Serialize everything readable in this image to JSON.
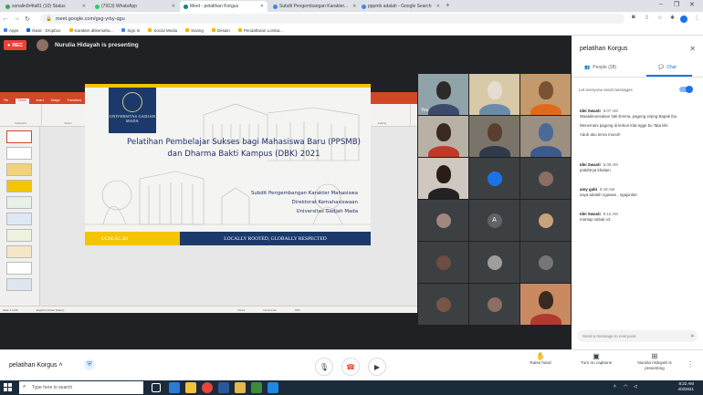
{
  "browser": {
    "tabs": [
      {
        "label": "sonalin9r4ta81 (10) Status",
        "color": "#34a853"
      },
      {
        "label": "(7913) WhatsApp",
        "color": "#25d366"
      },
      {
        "label": "Meet - pelatihan Korgus",
        "color": "#00897b"
      },
      {
        "label": "Subdit Pengembangan Karakter...",
        "color": "#4285f4"
      },
      {
        "label": "pppmb adalah - Google Search",
        "color": "#4285f4"
      }
    ],
    "new_tab": "+",
    "url": "meet.google.com/gsg-yrby-qgu",
    "bookmarks": [
      "Apps",
      "Ikwal · Dropbox",
      "Karakter ditkemaha...",
      "Sign In",
      "Social Media",
      "Saving",
      "Desain",
      "Pendaftaran Lomba..."
    ]
  },
  "meet": {
    "rec": "REC",
    "presenting": "Nurulia Hidayah is presenting",
    "you_label": "You",
    "avatar_letter": "A",
    "meeting_name": "pelatihan Korgus",
    "controls": {
      "raise_hand": "Raise hand",
      "captions": "Turn on captions",
      "presenting": "Nurulia Hidayah is presenting"
    }
  },
  "ppt": {
    "window_title": "PELATIHAN PEMBELAJAR SUKSES BAGI MAHASISWA BARU (PPSMB) DAN DHARMA BAKTI KAMPUS (DBK)_Pak Bu.pp - PowerPoint",
    "ribbon_tabs": [
      "File",
      "Home",
      "Insert",
      "Design",
      "Transitions",
      "Animations",
      "Slide Show",
      "Review",
      "View",
      "Help",
      "Tell me what you want to do"
    ],
    "ribbon_groups": [
      "Clipboard",
      "Slides",
      "Font",
      "Paragraph",
      "Drawing",
      "Editing"
    ],
    "status": [
      "Slide 1 of 56",
      "English (United States)",
      "Notes",
      "Comments",
      "79%"
    ]
  },
  "slide": {
    "logo_name": "UNIVERSITAS GADJAH MADA",
    "title": "Pelatihan Pembelajar Sukses bagi Mahasiswa Baru (PPSMB) dan Dharma Bakti Kampus (DBK) 2021",
    "subtitle_lines": [
      "Subdit Pengembangan Karakter Mahasiswa",
      "Direktorat Kemahasiswaan",
      "Universitas Gadjah Mada"
    ],
    "footer_left": "UGM.AC.ID",
    "footer_right": "LOCALLY ROOTED, GLOBALLY RESPECTED"
  },
  "chat": {
    "title": "pelatihan Korgus",
    "people_tab": "People (28)",
    "chat_tab": "Chat",
    "everyone_label": "Let everyone send messages",
    "messages": [
      {
        "sender": "Idei Swasti",
        "time": "8.07 AM",
        "lines": [
          "Waalaikumsalam hali Emma, pageng enjing Bapak Ibu",
          "Menemani pagung di kebun kita-ngge bu Tata kiki",
          "Aduh aku tenra monoh"
        ]
      },
      {
        "sender": "Idei Swasti",
        "time": "8.08 AM",
        "lines": [
          "prakhtrya khalam"
        ]
      },
      {
        "sender": "amy gabi",
        "time": "8.18 AM",
        "lines": [
          "saya adalah ngawas , ngajuniter"
        ]
      },
      {
        "sender": "Idei Swasti",
        "time": "8.12 AM",
        "lines": [
          "mantap sabak x3"
        ]
      }
    ],
    "input_placeholder": "Send a message to everyone"
  },
  "taskbar": {
    "search_placeholder": "Type here to search",
    "time": "8:22 AM",
    "date": "4/3/2021"
  }
}
